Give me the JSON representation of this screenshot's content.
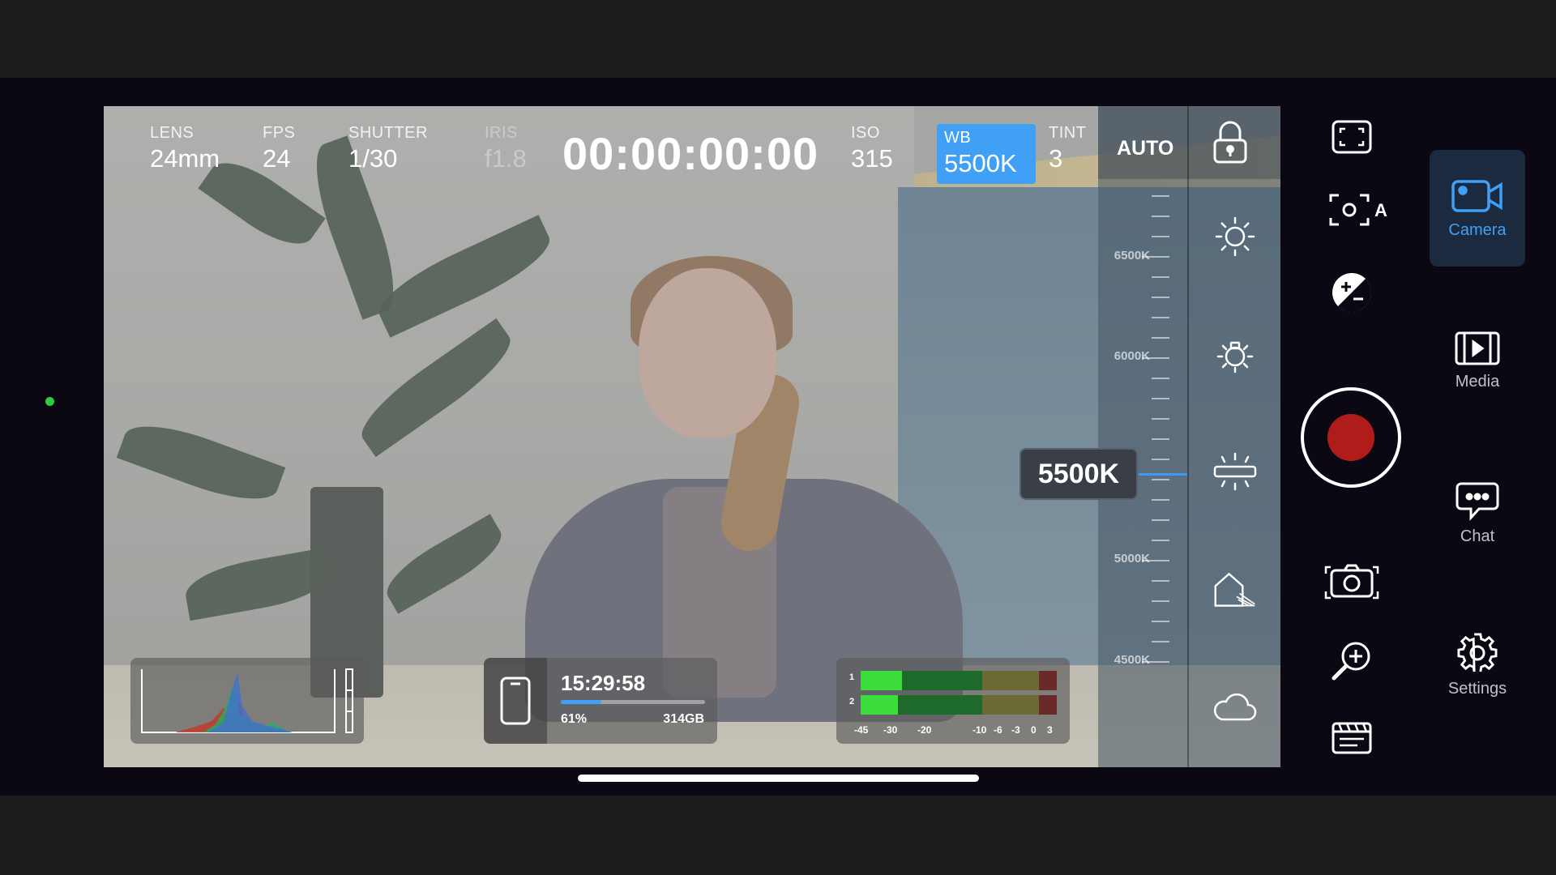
{
  "hud": {
    "lens_label": "LENS",
    "lens_value": "24mm",
    "fps_label": "FPS",
    "fps_value": "24",
    "shutter_label": "SHUTTER",
    "shutter_value": "1/30",
    "iris_label": "IRIS",
    "iris_value": "f1.8",
    "timecode": "00:00:00:00",
    "iso_label": "ISO",
    "iso_value": "315",
    "wb_label": "WB",
    "wb_value": "5500K",
    "tint_label": "TINT",
    "tint_value": "3",
    "auto_label": "AUTO"
  },
  "wb_scale": {
    "labels": [
      "6500K",
      "6000K",
      "5000K",
      "4500K"
    ],
    "current": "5500K"
  },
  "media": {
    "remaining_time": "15:29:58",
    "percent": "61%",
    "percent_fraction": 0.28,
    "space": "314GB"
  },
  "audio": {
    "channels": [
      "1",
      "2"
    ],
    "levels": [
      0.21,
      0.19
    ],
    "scale": [
      "-45",
      "-30",
      "-20",
      "-10",
      "-6",
      "-3",
      "0",
      "3"
    ]
  },
  "nav": {
    "camera": "Camera",
    "media": "Media",
    "chat": "Chat",
    "settings": "Settings"
  },
  "colors": {
    "accent": "#3fa0f6",
    "record": "#b01c1c"
  }
}
